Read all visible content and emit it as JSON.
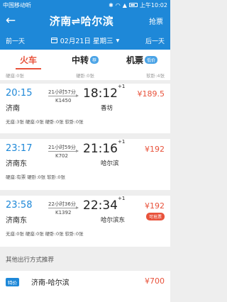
{
  "statusbar": {
    "carrier": "中国移动听",
    "time": "上午10:02"
  },
  "header": {
    "title": "济南⇌哈尔滨",
    "grab_label": "抢票"
  },
  "datebar": {
    "prev": "前一天",
    "date": "02月21日 星期三",
    "next": "后一天"
  },
  "tabs": [
    {
      "label": "火车",
      "badge": ""
    },
    {
      "label": "中转",
      "badge": "荐"
    },
    {
      "label": "机票",
      "badge": "低价"
    }
  ],
  "subrow": {
    "left": "硬座:0张",
    "middle": "硬卧:0张",
    "right": "软卧:4张"
  },
  "trains": [
    {
      "dep_time": "20:15",
      "dep_station": "济南",
      "duration": "21小时57分",
      "train_no": "K1450",
      "arr_time": "18:12",
      "day_offset": "+1",
      "arr_station": "香坊",
      "price": "¥189.5",
      "seats": "无座:3张    硬座:0张    硬卧:0张    软卧:0张",
      "tag": ""
    },
    {
      "dep_time": "23:17",
      "dep_station": "济南东",
      "duration": "21小时59分",
      "train_no": "K702",
      "arr_time": "21:16",
      "day_offset": "+1",
      "arr_station": "哈尔滨",
      "price": "¥192",
      "seats": "硬座:有票    硬卧:0张    软卧:0张",
      "tag": ""
    },
    {
      "dep_time": "23:58",
      "dep_station": "济南东",
      "duration": "22小时36分",
      "train_no": "K1392",
      "arr_time": "22:34",
      "day_offset": "+1",
      "arr_station": "哈尔滨东",
      "price": "¥192",
      "seats": "无座:0张    硬座:0张    硬卧:0张    软卧:0张",
      "tag": "可抢票"
    }
  ],
  "other": {
    "heading": "其他出行方式推荐",
    "tag": "特价",
    "route": "济南-哈尔滨",
    "price": "¥700"
  }
}
